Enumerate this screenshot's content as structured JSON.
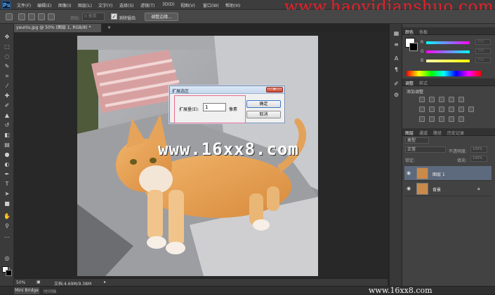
{
  "app": {
    "logo": "Ps"
  },
  "menu": {
    "items": [
      "文件(F)",
      "编辑(E)",
      "图像(I)",
      "图层(L)",
      "文字(Y)",
      "选择(S)",
      "滤镜(T)",
      "3D(D)",
      "视图(V)",
      "窗口(W)",
      "帮助(H)"
    ]
  },
  "watermark_top": "www.haoyidianshuo.com",
  "options": {
    "feather_label": "羽化:",
    "feather_value": "0 像素",
    "antialias_checked": "✓",
    "antialias_label": "消除锯齿",
    "refine_edge_label": "调整边缘..."
  },
  "document": {
    "tab_title": "yaunlu.jpg @ 50% (图层 1, RGB/8) *",
    "close_glyph": "×",
    "canvas_watermark": "www.16xx8.com"
  },
  "status": {
    "zoom": "50%",
    "doc_info": "文档:4.69M/9.38M"
  },
  "bottom": {
    "minibridge": "Mini Bridge",
    "timeline": "时间轴",
    "watermark": "www.16xx8.com"
  },
  "panels": {
    "color_tabs": [
      "颜色",
      "色板"
    ],
    "color_sliders": [
      {
        "label": "R",
        "value": "255",
        "gradient": "#ff00ff"
      },
      {
        "label": "G",
        "value": "255",
        "gradient": "#00ffff"
      },
      {
        "label": "B",
        "value": "255",
        "gradient": "#ffff00"
      }
    ],
    "adjust_tabs": [
      "调整",
      "样式"
    ],
    "adjust_title": "添加调整",
    "layer_tabs": [
      "图层",
      "通道",
      "路径",
      "历史记录"
    ],
    "layer_kind": "类型",
    "blend_mode": "正常",
    "opacity_label": "不透明度:",
    "opacity_value": "100%",
    "lock_label": "锁定:",
    "fill_label": "填充:",
    "fill_value": "100%",
    "layers": [
      {
        "name": "图层 1",
        "selected": true
      },
      {
        "name": "背景",
        "selected": false
      }
    ]
  },
  "dialog": {
    "title": "扩展选区",
    "close_glyph": "✕",
    "expand_label": "扩展量(E):",
    "expand_value": "1",
    "unit": "像素",
    "ok_label": "确定",
    "cancel_label": "取消"
  },
  "colors": {
    "accent_blue": "#3a78c8",
    "highlight_pink": "#e66c8f",
    "watermark_red": "#e5202a"
  }
}
